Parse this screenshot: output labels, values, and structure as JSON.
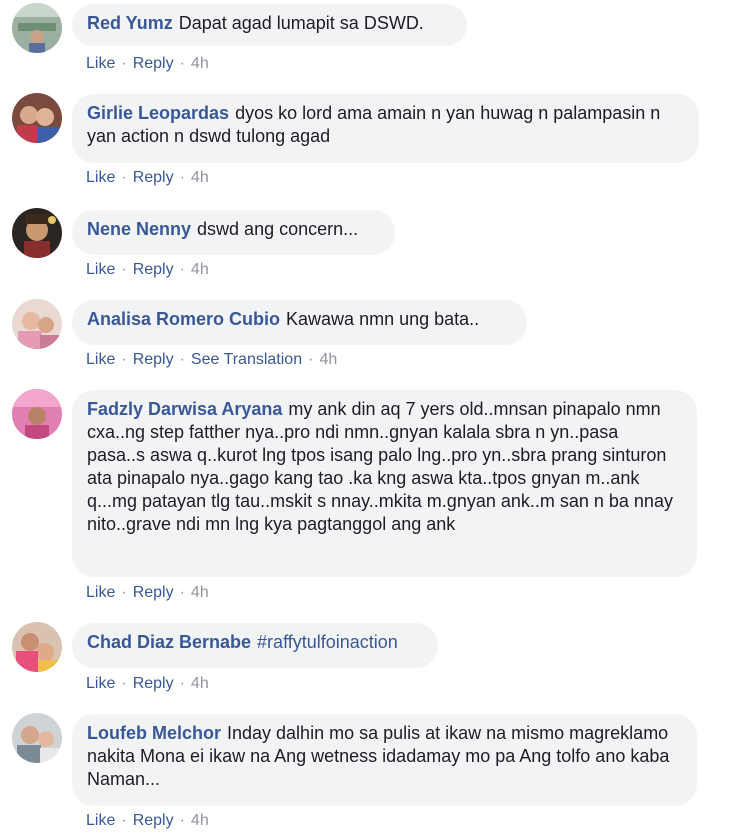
{
  "actions": {
    "like": "Like",
    "reply": "Reply",
    "see_translation": "See Translation",
    "separator": "·"
  },
  "colors": {
    "author_link": "#385898",
    "bubble_bg": "#f2f3f5",
    "meta_gray": "#90949c",
    "text": "#1c1e21"
  },
  "comments": [
    {
      "author": "Red Yumz",
      "text": "Dapat agad lumapit sa DSWD.",
      "time": "4h"
    },
    {
      "author": "Girlie Leopardas",
      "text": "dyos ko lord ama amain n yan huwag n palampasin n yan action n dswd tulong agad",
      "time": "4h"
    },
    {
      "author": "Nene Nenny",
      "text": "dswd ang concern...",
      "time": "4h"
    },
    {
      "author": "Analisa Romero Cubio",
      "text": "Kawawa nmn ung bata..",
      "time": "4h"
    },
    {
      "author": "Fadzly Darwisa Aryana",
      "text": "my ank din aq 7 yers old..mnsan pinapalo nmn cxa..ng step fatther nya..pro ndi nmn..gnyan kalala sbra n yn..pasa pasa..s aswa q..kurot lng tpos isang palo lng..pro yn..sbra prang sinturon ata pinapalo nya..gago kang tao .ka kng aswa kta..tpos gnyan m..ank q...mg patayan tlg tau..mskit s nnay..mkita m.gnyan ank..m san n ba nnay nito..grave ndi mn lng kya pagtanggol ang ank",
      "time": "4h"
    },
    {
      "author": "Chad Diaz Bernabe",
      "text": "#raffytulfoinaction",
      "time": "4h"
    },
    {
      "author": "Loufeb Melchor",
      "text": "Inday dalhin mo sa pulis at ikaw na mismo magreklamo nakita Mona ei ikaw na Ang wetness idadamay mo pa Ang tolfo ano kaba Naman...",
      "time": "4h"
    }
  ]
}
